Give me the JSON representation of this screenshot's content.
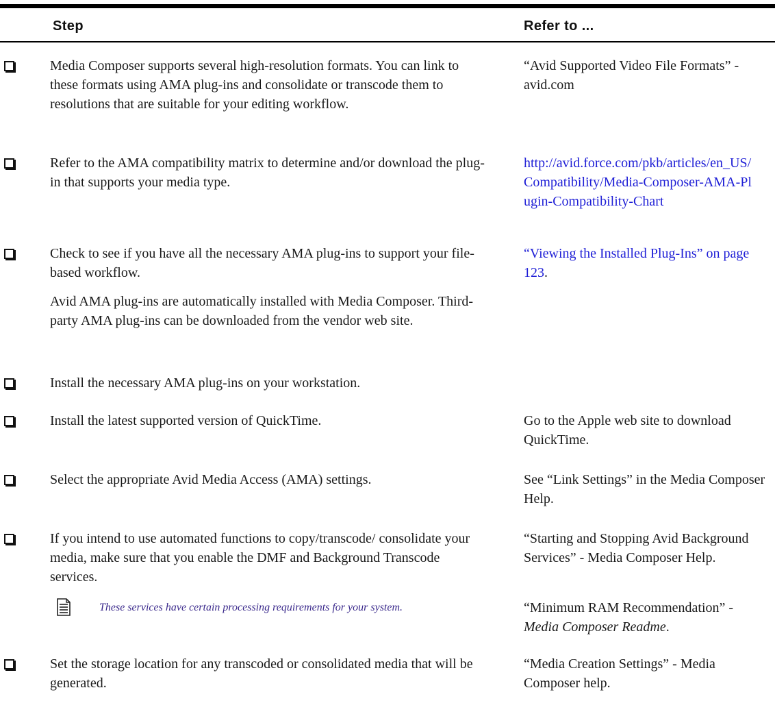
{
  "header": {
    "step_label": "Step",
    "refer_label": "Refer to ..."
  },
  "rows": [
    {
      "step": "Media Composer supports several high-resolution formats. You can link to these formats using AMA plug-ins and consolidate or transcode them to resolutions that are suitable for your editing workflow.",
      "refer": "“Avid Supported Video File Formats” - avid.com"
    },
    {
      "step": "Refer to the AMA compatibility matrix to determine and/or download the plug-in that supports your media type.",
      "refer_link": "http://avid.force.com/pkb/articles/en_US/Compatibility/Media-Composer-AMA-Plugin-Compatibility-Chart"
    },
    {
      "step": "Check to see if you have all the necessary AMA plug-ins to support your file-based workflow.",
      "step_extra": "Avid AMA plug-ins are automatically installed with Media Composer. Third-party AMA plug-ins can be downloaded from the vendor web site.",
      "refer_link": "“Viewing the Installed Plug-Ins” on page 123",
      "refer_suffix": "."
    },
    {
      "step": "Install the necessary AMA plug-ins on your workstation.",
      "refer": ""
    },
    {
      "step": "Install the latest supported version of QuickTime.",
      "refer": "Go to the Apple web site to download QuickTime."
    },
    {
      "step": "Select the appropriate Avid Media Access (AMA) settings.",
      "refer": "See “Link Settings” in the Media Composer Help."
    },
    {
      "step": "If you intend to use automated functions to copy/transcode/ consolidate your media, make sure that you enable the DMF and Background Transcode services.",
      "refer": "“Starting and Stopping Avid Background Services” - Media Composer Help."
    },
    {
      "note": "These services have certain processing requirements for your system.",
      "note_refer_prefix": "“Minimum RAM Recommendation” - ",
      "note_refer_italic": "Media Composer Readme",
      "note_refer_suffix": "."
    },
    {
      "step": "Set the storage location for any transcoded or consolidated media that will be generated.",
      "refer": "“Media Creation Settings” - Media Composer help."
    }
  ],
  "icons": {
    "checkbox": "checkbox-icon",
    "note": "note-icon"
  },
  "colors": {
    "link": "#1f1fd6",
    "note_text": "#3b2a8c",
    "rule": "#000000"
  }
}
